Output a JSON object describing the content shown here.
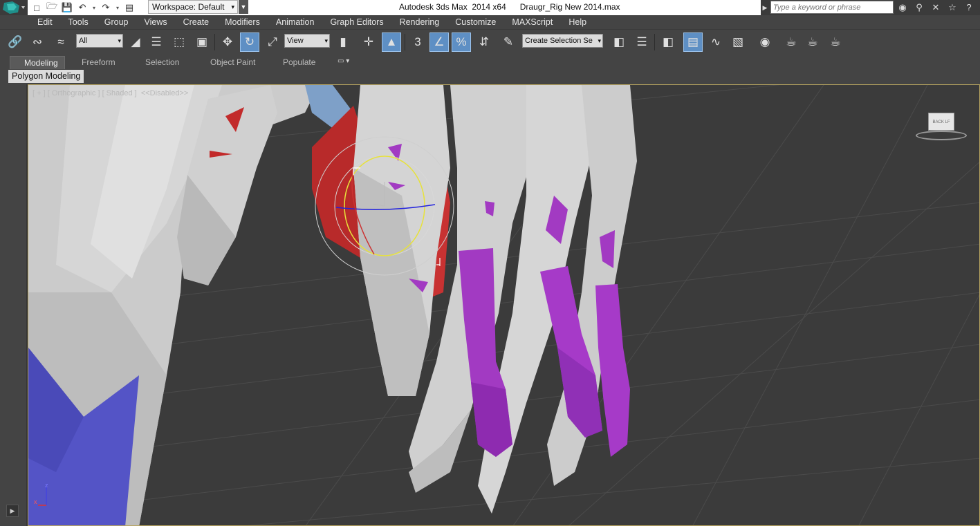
{
  "titlebar": {
    "workspace_label": "Workspace: Default",
    "app_title": "Autodesk 3ds Max  2014 x64      Draugr_Rig New 2014.max",
    "search_placeholder": "Type a keyword or phrase"
  },
  "menu": {
    "items": [
      "Edit",
      "Tools",
      "Group",
      "Views",
      "Create",
      "Modifiers",
      "Animation",
      "Graph Editors",
      "Rendering",
      "Customize",
      "MAXScript",
      "Help"
    ]
  },
  "toolbar": {
    "selection_filter": "All",
    "ref_coord_system": "View",
    "named_selection_placeholder": "Create Selection Se",
    "snap_number": "3"
  },
  "ribbon": {
    "tabs": [
      "Modeling",
      "Freeform",
      "Selection",
      "Object Paint",
      "Populate"
    ],
    "active_tab": "Modeling",
    "panel_label": "Polygon Modeling"
  },
  "viewport": {
    "label": "[ + ] [ Orthographic ] [ Shaded ]  <<Disabled>>",
    "viewcube_faces": "BACK  LF",
    "axis_x": "x",
    "axis_z": "z"
  },
  "colors": {
    "accent_active": "#5e8fc4",
    "viewport_bg": "#3b3b3b",
    "mesh_gray": "#c8c8c8",
    "bone_purple": "#a23ac2",
    "muscle_red": "#b52b2b",
    "cloth_blue": "#5050c0"
  },
  "icons": {
    "app": "3ds-max-logo-icon",
    "gizmo": "rotate-gizmo-icon"
  }
}
